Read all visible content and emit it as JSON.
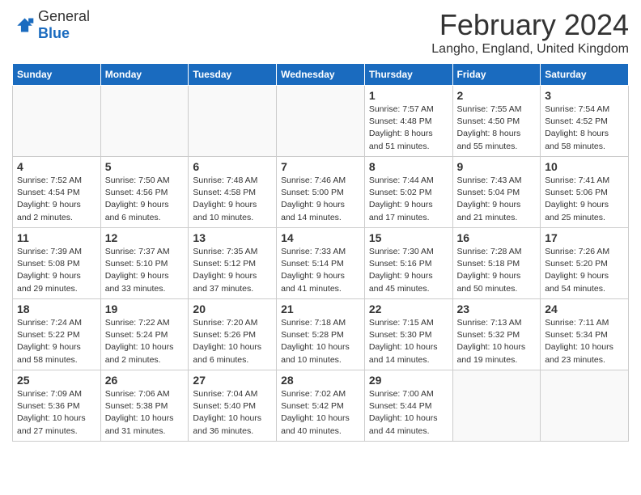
{
  "logo": {
    "general": "General",
    "blue": "Blue"
  },
  "title": "February 2024",
  "location": "Langho, England, United Kingdom",
  "days_of_week": [
    "Sunday",
    "Monday",
    "Tuesday",
    "Wednesday",
    "Thursday",
    "Friday",
    "Saturday"
  ],
  "weeks": [
    [
      {
        "day": "",
        "info": ""
      },
      {
        "day": "",
        "info": ""
      },
      {
        "day": "",
        "info": ""
      },
      {
        "day": "",
        "info": ""
      },
      {
        "day": "1",
        "info": "Sunrise: 7:57 AM\nSunset: 4:48 PM\nDaylight: 8 hours and 51 minutes."
      },
      {
        "day": "2",
        "info": "Sunrise: 7:55 AM\nSunset: 4:50 PM\nDaylight: 8 hours and 55 minutes."
      },
      {
        "day": "3",
        "info": "Sunrise: 7:54 AM\nSunset: 4:52 PM\nDaylight: 8 hours and 58 minutes."
      }
    ],
    [
      {
        "day": "4",
        "info": "Sunrise: 7:52 AM\nSunset: 4:54 PM\nDaylight: 9 hours and 2 minutes."
      },
      {
        "day": "5",
        "info": "Sunrise: 7:50 AM\nSunset: 4:56 PM\nDaylight: 9 hours and 6 minutes."
      },
      {
        "day": "6",
        "info": "Sunrise: 7:48 AM\nSunset: 4:58 PM\nDaylight: 9 hours and 10 minutes."
      },
      {
        "day": "7",
        "info": "Sunrise: 7:46 AM\nSunset: 5:00 PM\nDaylight: 9 hours and 14 minutes."
      },
      {
        "day": "8",
        "info": "Sunrise: 7:44 AM\nSunset: 5:02 PM\nDaylight: 9 hours and 17 minutes."
      },
      {
        "day": "9",
        "info": "Sunrise: 7:43 AM\nSunset: 5:04 PM\nDaylight: 9 hours and 21 minutes."
      },
      {
        "day": "10",
        "info": "Sunrise: 7:41 AM\nSunset: 5:06 PM\nDaylight: 9 hours and 25 minutes."
      }
    ],
    [
      {
        "day": "11",
        "info": "Sunrise: 7:39 AM\nSunset: 5:08 PM\nDaylight: 9 hours and 29 minutes."
      },
      {
        "day": "12",
        "info": "Sunrise: 7:37 AM\nSunset: 5:10 PM\nDaylight: 9 hours and 33 minutes."
      },
      {
        "day": "13",
        "info": "Sunrise: 7:35 AM\nSunset: 5:12 PM\nDaylight: 9 hours and 37 minutes."
      },
      {
        "day": "14",
        "info": "Sunrise: 7:33 AM\nSunset: 5:14 PM\nDaylight: 9 hours and 41 minutes."
      },
      {
        "day": "15",
        "info": "Sunrise: 7:30 AM\nSunset: 5:16 PM\nDaylight: 9 hours and 45 minutes."
      },
      {
        "day": "16",
        "info": "Sunrise: 7:28 AM\nSunset: 5:18 PM\nDaylight: 9 hours and 50 minutes."
      },
      {
        "day": "17",
        "info": "Sunrise: 7:26 AM\nSunset: 5:20 PM\nDaylight: 9 hours and 54 minutes."
      }
    ],
    [
      {
        "day": "18",
        "info": "Sunrise: 7:24 AM\nSunset: 5:22 PM\nDaylight: 9 hours and 58 minutes."
      },
      {
        "day": "19",
        "info": "Sunrise: 7:22 AM\nSunset: 5:24 PM\nDaylight: 10 hours and 2 minutes."
      },
      {
        "day": "20",
        "info": "Sunrise: 7:20 AM\nSunset: 5:26 PM\nDaylight: 10 hours and 6 minutes."
      },
      {
        "day": "21",
        "info": "Sunrise: 7:18 AM\nSunset: 5:28 PM\nDaylight: 10 hours and 10 minutes."
      },
      {
        "day": "22",
        "info": "Sunrise: 7:15 AM\nSunset: 5:30 PM\nDaylight: 10 hours and 14 minutes."
      },
      {
        "day": "23",
        "info": "Sunrise: 7:13 AM\nSunset: 5:32 PM\nDaylight: 10 hours and 19 minutes."
      },
      {
        "day": "24",
        "info": "Sunrise: 7:11 AM\nSunset: 5:34 PM\nDaylight: 10 hours and 23 minutes."
      }
    ],
    [
      {
        "day": "25",
        "info": "Sunrise: 7:09 AM\nSunset: 5:36 PM\nDaylight: 10 hours and 27 minutes."
      },
      {
        "day": "26",
        "info": "Sunrise: 7:06 AM\nSunset: 5:38 PM\nDaylight: 10 hours and 31 minutes."
      },
      {
        "day": "27",
        "info": "Sunrise: 7:04 AM\nSunset: 5:40 PM\nDaylight: 10 hours and 36 minutes."
      },
      {
        "day": "28",
        "info": "Sunrise: 7:02 AM\nSunset: 5:42 PM\nDaylight: 10 hours and 40 minutes."
      },
      {
        "day": "29",
        "info": "Sunrise: 7:00 AM\nSunset: 5:44 PM\nDaylight: 10 hours and 44 minutes."
      },
      {
        "day": "",
        "info": ""
      },
      {
        "day": "",
        "info": ""
      }
    ]
  ]
}
